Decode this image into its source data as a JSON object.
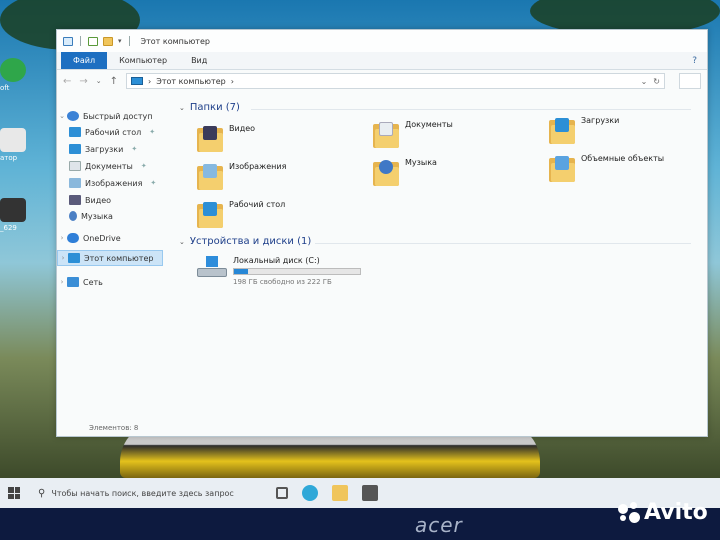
{
  "window": {
    "title": "Этот компьютер",
    "ribbon_tabs": [
      "Файл",
      "Компьютер",
      "Вид"
    ],
    "ribbon_help": "?",
    "address": {
      "location": "Этот компьютер",
      "separator": "›",
      "crumb_arrow": "›"
    },
    "nav": {
      "quick_access": "Быстрый доступ",
      "items": [
        {
          "label": "Рабочий стол",
          "pinned": true
        },
        {
          "label": "Загрузки",
          "pinned": true
        },
        {
          "label": "Документы",
          "pinned": true
        },
        {
          "label": "Изображения",
          "pinned": true
        },
        {
          "label": "Видео",
          "pinned": false
        },
        {
          "label": "Музыка",
          "pinned": false
        }
      ],
      "onedrive": "OneDrive",
      "this_pc": "Этот компьютер",
      "network": "Сеть"
    },
    "main": {
      "folders_header": "Папки (7)",
      "folders": [
        "Видео",
        "Документы",
        "Загрузки",
        "Изображения",
        "Музыка",
        "Объемные объекты",
        "Рабочий стол"
      ],
      "devices_header": "Устройства и диски (1)",
      "drive": {
        "name": "Локальный диск (C:)",
        "free_text": "198 ГБ свободно из 222 ГБ",
        "used_fraction": 0.11
      }
    },
    "status": "Элементов: 8"
  },
  "taskbar": {
    "search_placeholder": "Чтобы начать поиск, введите здесь запрос"
  },
  "desktop": {
    "icon_labels": [
      "oft",
      "атор",
      "_629"
    ]
  },
  "watermark": {
    "brand": "acer",
    "site": "Avito"
  },
  "colors": {
    "accent": "#1d6fc1",
    "folder": "#f4cf6e",
    "drive_fill": "#2687d6"
  }
}
